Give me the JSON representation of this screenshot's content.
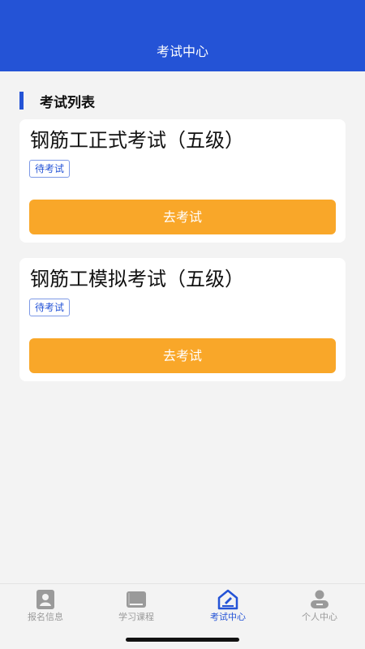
{
  "header": {
    "title": "考试中心"
  },
  "section": {
    "title": "考试列表"
  },
  "exams": [
    {
      "title": "钢筋工正式考试（五级）",
      "status": "待考试",
      "button": "去考试"
    },
    {
      "title": "钢筋工模拟考试（五级）",
      "status": "待考试",
      "button": "去考试"
    }
  ],
  "tabs": [
    {
      "label": "报名信息",
      "icon": "id-card-icon"
    },
    {
      "label": "学习课程",
      "icon": "book-icon"
    },
    {
      "label": "考试中心",
      "icon": "exam-pen-icon",
      "active": true
    },
    {
      "label": "个人中心",
      "icon": "person-icon"
    }
  ],
  "colors": {
    "primary": "#2453d6",
    "button": "#f9a729",
    "inactive": "#9a9a9a"
  }
}
